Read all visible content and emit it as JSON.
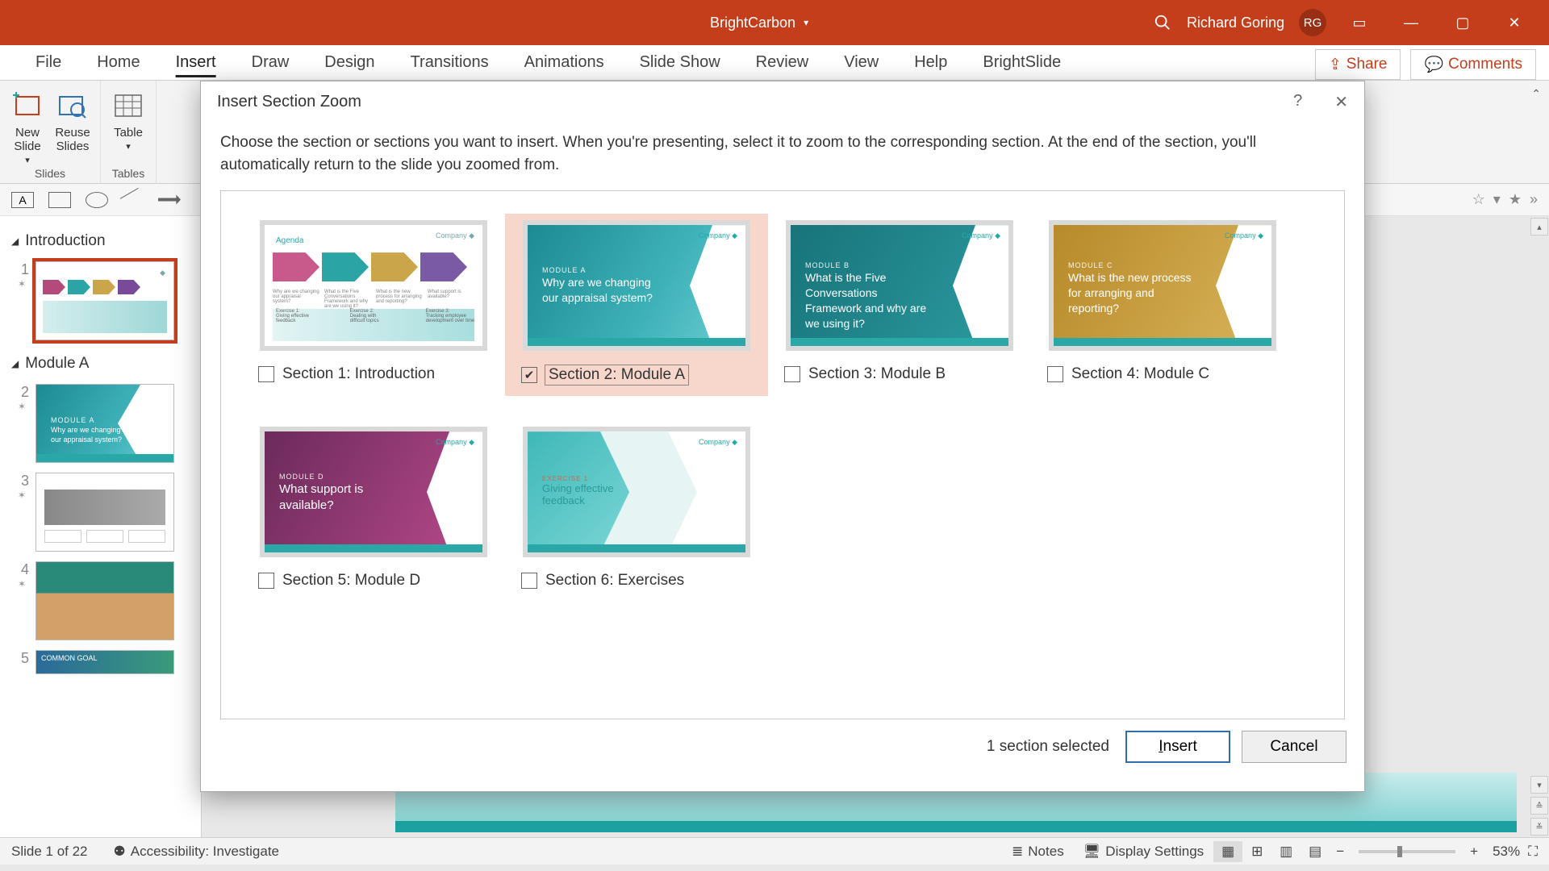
{
  "titlebar": {
    "doc_name": "BrightCarbon",
    "user_name": "Richard Goring",
    "user_initials": "RG"
  },
  "ribbon": {
    "tabs": [
      "File",
      "Home",
      "Insert",
      "Draw",
      "Design",
      "Transitions",
      "Animations",
      "Slide Show",
      "Review",
      "View",
      "Help",
      "BrightSlide"
    ],
    "active_tab": "Insert",
    "share": "Share",
    "comments": "Comments",
    "group_slides": "Slides",
    "group_tables": "Tables",
    "btn_new_slide": "New\nSlide",
    "btn_reuse": "Reuse\nSlides",
    "btn_table": "Table"
  },
  "sections": {
    "intro": "Introduction",
    "mod_a": "Module A"
  },
  "thumbs": {
    "s2_lbl": "MODULE A",
    "s2_txt": "Why are we changing our appraisal system?"
  },
  "dialog": {
    "title": "Insert Section Zoom",
    "instructions": "Choose the section or sections you want to insert. When you're presenting, select it to zoom to the corresponding section. At the end of the section, you'll automatically return to the slide you zoomed from.",
    "sections": [
      {
        "label": "Section 1: Introduction",
        "checked": false,
        "module": "",
        "text": "Agenda"
      },
      {
        "label": "Section 2: Module A",
        "checked": true,
        "module": "MODULE A",
        "text": "Why are we changing our appraisal system?"
      },
      {
        "label": "Section 3: Module B",
        "checked": false,
        "module": "MODULE B",
        "text": "What is the Five Conversations Framework and why are we using it?"
      },
      {
        "label": "Section 4: Module C",
        "checked": false,
        "module": "MODULE C",
        "text": "What is the new process for arranging and reporting?"
      },
      {
        "label": "Section 5: Module D",
        "checked": false,
        "module": "MODULE D",
        "text": "What support is available?"
      },
      {
        "label": "Section 6: Exercises",
        "checked": false,
        "module": "EXERCISE 1",
        "text": "Giving effective feedback"
      }
    ],
    "selected_status": "1 section selected",
    "insert": "Insert",
    "cancel": "Cancel"
  },
  "statusbar": {
    "slide": "Slide 1 of 22",
    "accessibility": "Accessibility: Investigate",
    "notes": "Notes",
    "display": "Display Settings",
    "zoom": "53%"
  }
}
